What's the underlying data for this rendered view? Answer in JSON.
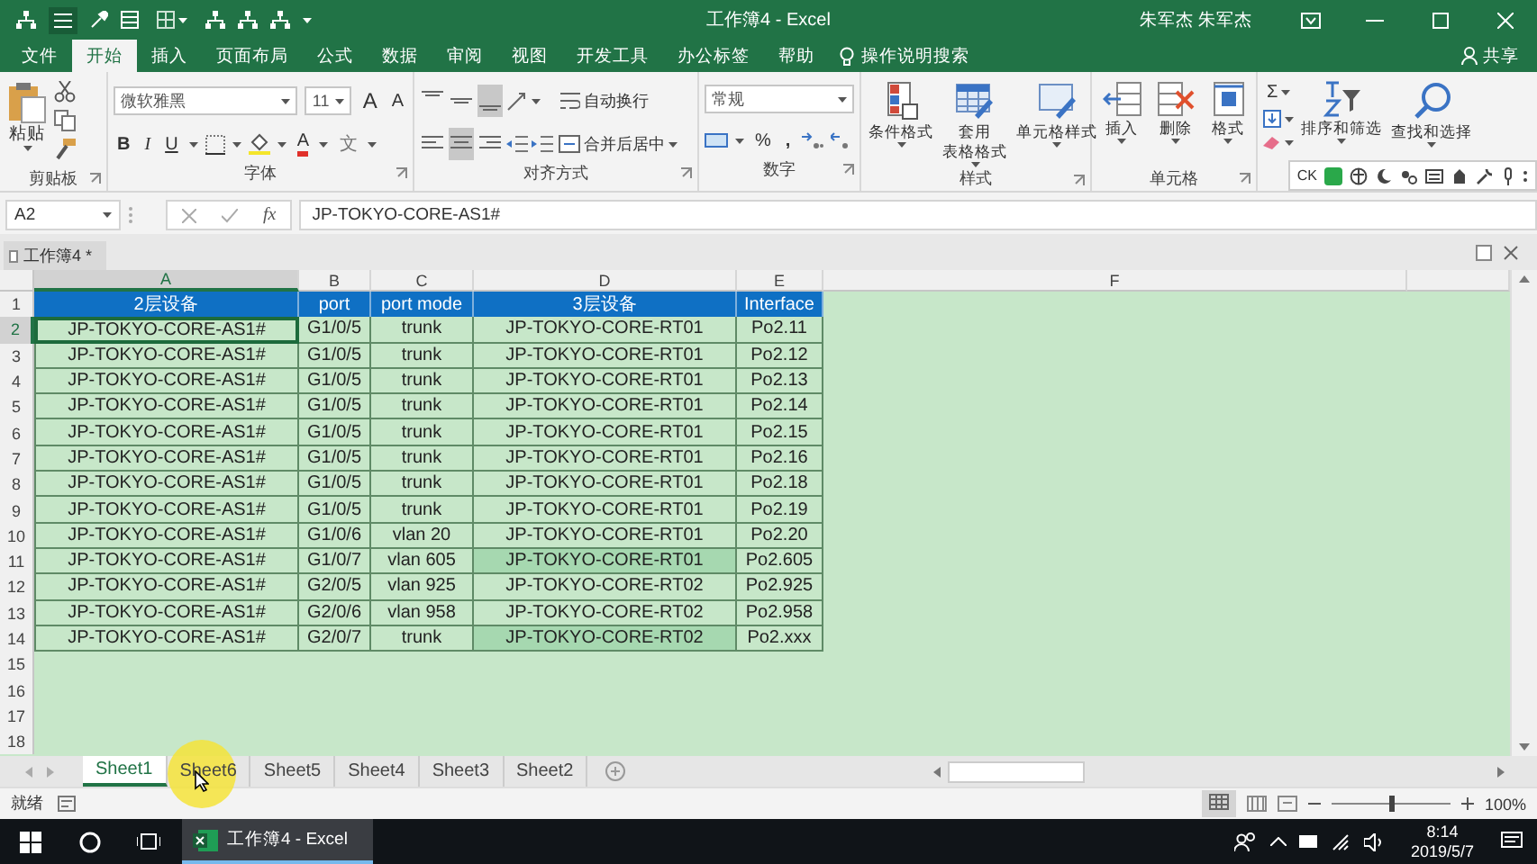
{
  "window": {
    "title": "工作簿4 - Excel",
    "user": "朱军杰 朱军杰"
  },
  "ribbon_tabs": [
    {
      "label": "文件",
      "selected": false
    },
    {
      "label": "开始",
      "selected": true
    },
    {
      "label": "插入",
      "selected": false
    },
    {
      "label": "页面布局",
      "selected": false
    },
    {
      "label": "公式",
      "selected": false
    },
    {
      "label": "数据",
      "selected": false
    },
    {
      "label": "审阅",
      "selected": false
    },
    {
      "label": "视图",
      "selected": false
    },
    {
      "label": "开发工具",
      "selected": false
    },
    {
      "label": "办公标签",
      "selected": false
    },
    {
      "label": "帮助",
      "selected": false
    }
  ],
  "search": {
    "placeholder": "操作说明搜索"
  },
  "share": "共享",
  "ribbon": {
    "groups": [
      {
        "kind": "clipboard",
        "label": "剪贴板",
        "paste": "粘贴"
      },
      {
        "kind": "font",
        "label": "字体",
        "font_name": "微软雅黑",
        "font_size": "11",
        "grow": "A",
        "shrink": "A",
        "bold": "B",
        "italic": "I",
        "underline": "U",
        "font_color": "A",
        "phonetic": "文"
      },
      {
        "kind": "alignment",
        "label": "对齐方式",
        "wrap": "自动换行",
        "merge": "合并后居中",
        "vertical_align": [
          {
            "selected": false
          },
          {
            "selected": false
          },
          {
            "selected": true
          }
        ],
        "horizontal_align": [
          {
            "selected": false
          },
          {
            "selected": true
          },
          {
            "selected": false
          }
        ]
      },
      {
        "kind": "number",
        "label": "数字",
        "format": "常规",
        "percent": "%",
        "comma": ","
      },
      {
        "kind": "styles",
        "label": "样式",
        "buttons": [
          {
            "lines": [
              "条件格式"
            ]
          },
          {
            "lines": [
              "套用",
              "表格格式"
            ]
          },
          {
            "lines": [
              "单元格样式"
            ]
          }
        ]
      },
      {
        "kind": "cells",
        "label": "单元格",
        "buttons": [
          {
            "lines": [
              "插入"
            ]
          },
          {
            "lines": [
              "删除"
            ]
          },
          {
            "lines": [
              "格式"
            ]
          }
        ]
      },
      {
        "kind": "editing",
        "sum": "Σ",
        "buttons": [
          {
            "lines": [
              "排序和筛选"
            ]
          },
          {
            "lines": [
              "查找和选择"
            ]
          }
        ]
      }
    ]
  },
  "ime_toolbar": {
    "label": "CK"
  },
  "formula_bar": {
    "name_box": "A2",
    "fx": "fx",
    "value": "JP-TOKYO-CORE-AS1#"
  },
  "workbook_tab": "工作簿4 *",
  "sheet": {
    "columns": [
      {
        "letter": "A",
        "selected": true
      },
      {
        "letter": "B",
        "selected": false
      },
      {
        "letter": "C",
        "selected": false
      },
      {
        "letter": "D",
        "selected": false
      },
      {
        "letter": "E",
        "selected": false
      },
      {
        "letter": "F",
        "selected": false
      }
    ],
    "header": {
      "number": "1",
      "cells": [
        "2层设备",
        "port",
        "port mode",
        "3层设备",
        "Interface"
      ]
    },
    "rows": [
      {
        "number": "2",
        "selected": true,
        "highlight": false,
        "cells": [
          "JP-TOKYO-CORE-AS1#",
          "G1/0/5",
          "trunk",
          "JP-TOKYO-CORE-RT01",
          "Po2.11"
        ]
      },
      {
        "number": "3",
        "selected": false,
        "highlight": false,
        "cells": [
          "JP-TOKYO-CORE-AS1#",
          "G1/0/5",
          "trunk",
          "JP-TOKYO-CORE-RT01",
          "Po2.12"
        ]
      },
      {
        "number": "4",
        "selected": false,
        "highlight": false,
        "cells": [
          "JP-TOKYO-CORE-AS1#",
          "G1/0/5",
          "trunk",
          "JP-TOKYO-CORE-RT01",
          "Po2.13"
        ]
      },
      {
        "number": "5",
        "selected": false,
        "highlight": false,
        "cells": [
          "JP-TOKYO-CORE-AS1#",
          "G1/0/5",
          "trunk",
          "JP-TOKYO-CORE-RT01",
          "Po2.14"
        ]
      },
      {
        "number": "6",
        "selected": false,
        "highlight": false,
        "cells": [
          "JP-TOKYO-CORE-AS1#",
          "G1/0/5",
          "trunk",
          "JP-TOKYO-CORE-RT01",
          "Po2.15"
        ]
      },
      {
        "number": "7",
        "selected": false,
        "highlight": false,
        "cells": [
          "JP-TOKYO-CORE-AS1#",
          "G1/0/5",
          "trunk",
          "JP-TOKYO-CORE-RT01",
          "Po2.16"
        ]
      },
      {
        "number": "8",
        "selected": false,
        "highlight": false,
        "cells": [
          "JP-TOKYO-CORE-AS1#",
          "G1/0/5",
          "trunk",
          "JP-TOKYO-CORE-RT01",
          "Po2.18"
        ]
      },
      {
        "number": "9",
        "selected": false,
        "highlight": false,
        "cells": [
          "JP-TOKYO-CORE-AS1#",
          "G1/0/5",
          "trunk",
          "JP-TOKYO-CORE-RT01",
          "Po2.19"
        ]
      },
      {
        "number": "10",
        "selected": false,
        "highlight": false,
        "cells": [
          "JP-TOKYO-CORE-AS1#",
          "G1/0/6",
          "vlan 20",
          "JP-TOKYO-CORE-RT01",
          "Po2.20"
        ]
      },
      {
        "number": "11",
        "selected": false,
        "highlight": true,
        "cells": [
          "JP-TOKYO-CORE-AS1#",
          "G1/0/7",
          "vlan 605",
          "JP-TOKYO-CORE-RT01",
          "Po2.605"
        ]
      },
      {
        "number": "12",
        "selected": false,
        "highlight": false,
        "cells": [
          "JP-TOKYO-CORE-AS1#",
          "G2/0/5",
          "vlan 925",
          "JP-TOKYO-CORE-RT02",
          "Po2.925"
        ]
      },
      {
        "number": "13",
        "selected": false,
        "highlight": false,
        "cells": [
          "JP-TOKYO-CORE-AS1#",
          "G2/0/6",
          "vlan 958",
          "JP-TOKYO-CORE-RT02",
          "Po2.958"
        ]
      },
      {
        "number": "14",
        "selected": false,
        "highlight": true,
        "cells": [
          "JP-TOKYO-CORE-AS1#",
          "G2/0/7",
          "trunk",
          "JP-TOKYO-CORE-RT02",
          "Po2.xxx"
        ]
      }
    ],
    "empty_rows": [
      "15",
      "16",
      "17",
      "18"
    ]
  },
  "sheet_tabs": [
    {
      "label": "Sheet1",
      "selected": true
    },
    {
      "label": "Sheet6",
      "selected": false
    },
    {
      "label": "Sheet5",
      "selected": false
    },
    {
      "label": "Sheet4",
      "selected": false
    },
    {
      "label": "Sheet3",
      "selected": false
    },
    {
      "label": "Sheet2",
      "selected": false
    }
  ],
  "status_bar": {
    "text": "就绪",
    "zoom": "100%",
    "zoom_slider": {
      "level": 0.5
    }
  },
  "taskbar": {
    "app": "工作簿4 - Excel",
    "time": "8:14",
    "date": "2019/5/7"
  }
}
